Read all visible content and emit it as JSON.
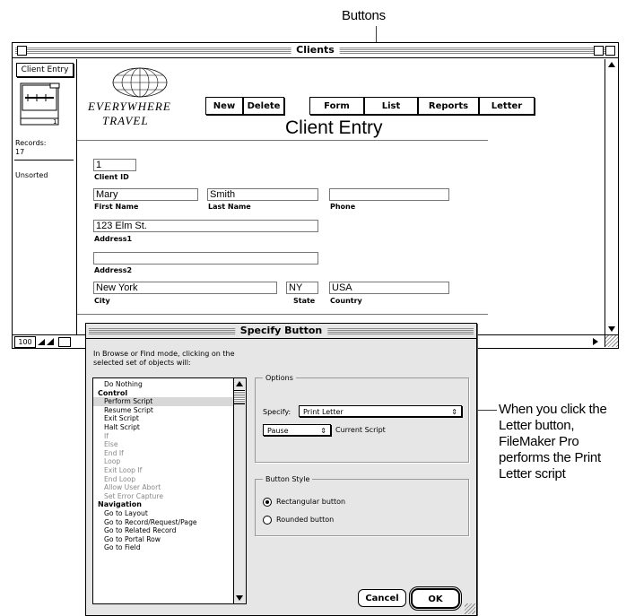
{
  "callouts": {
    "buttons_label": "Buttons",
    "letter_note": [
      "When you click the",
      "Letter button,",
      "FileMaker Pro",
      "performs the Print",
      "Letter script"
    ]
  },
  "window": {
    "title": "Clients",
    "layout_menu": "Client Entry",
    "book_page": "1",
    "records_label": "Records:",
    "records_count": "17",
    "sort_status": "Unsorted",
    "zoom_level": "100"
  },
  "logo": {
    "line1": "EVERYWHERE",
    "line2": "TRAVEL"
  },
  "layout_title": "Client Entry",
  "toolbar": [
    "New",
    "Delete",
    "Form",
    "List",
    "Reports",
    "Letter"
  ],
  "fields": {
    "client_id": {
      "value": "1",
      "label": "Client ID"
    },
    "first_name": {
      "value": "Mary",
      "label": "First Name"
    },
    "last_name": {
      "value": "Smith",
      "label": "Last Name"
    },
    "phone": {
      "value": "",
      "label": "Phone"
    },
    "address1": {
      "value": "123 Elm St.",
      "label": "Address1"
    },
    "address2": {
      "value": "",
      "label": "Address2"
    },
    "city": {
      "value": "New York",
      "label": "City"
    },
    "state": {
      "value": "NY",
      "label": "State"
    },
    "country": {
      "value": "USA",
      "label": "Country"
    }
  },
  "dialog": {
    "title": "Specify Button",
    "instructions": [
      "In Browse or Find mode, clicking on the",
      "selected set of objects will:"
    ],
    "steps": [
      {
        "text": "Do Nothing",
        "kind": "item"
      },
      {
        "text": "Control",
        "kind": "header"
      },
      {
        "text": "Perform Script",
        "kind": "selected"
      },
      {
        "text": "Resume Script",
        "kind": "item"
      },
      {
        "text": "Exit Script",
        "kind": "item"
      },
      {
        "text": "Halt Script",
        "kind": "item"
      },
      {
        "text": "If",
        "kind": "dim"
      },
      {
        "text": "Else",
        "kind": "dim"
      },
      {
        "text": "End If",
        "kind": "dim"
      },
      {
        "text": "Loop",
        "kind": "dim"
      },
      {
        "text": "Exit Loop If",
        "kind": "dim"
      },
      {
        "text": "End Loop",
        "kind": "dim"
      },
      {
        "text": "Allow User Abort",
        "kind": "dim"
      },
      {
        "text": "Set Error Capture",
        "kind": "dim"
      },
      {
        "text": "Navigation",
        "kind": "header"
      },
      {
        "text": "Go to Layout",
        "kind": "item"
      },
      {
        "text": "Go to Record/Request/Page",
        "kind": "item"
      },
      {
        "text": "Go to Related Record",
        "kind": "item"
      },
      {
        "text": "Go to Portal Row",
        "kind": "item"
      },
      {
        "text": "Go to Field",
        "kind": "item"
      }
    ],
    "options_label": "Options",
    "specify_label": "Specify:",
    "specify_value": "Print Letter",
    "pause_value": "Pause",
    "current_script_label": "Current Script",
    "button_style_label": "Button Style",
    "rect_label": "Rectangular button",
    "round_label": "Rounded button",
    "cancel_label": "Cancel",
    "ok_label": "OK"
  }
}
